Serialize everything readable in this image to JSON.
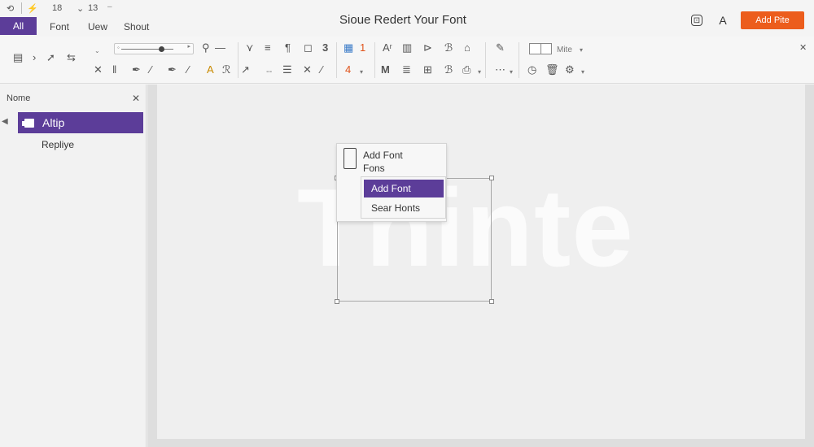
{
  "titlebar": {
    "quick_access": [
      {
        "icon": "undo-icon",
        "glyph": "⟲"
      },
      {
        "icon": "lightning-icon",
        "glyph": "⚡"
      },
      {
        "label": "18"
      },
      {
        "icon": "chevron-down-icon",
        "glyph": "⌄"
      },
      {
        "label": "13"
      }
    ],
    "tabs": [
      {
        "label": "All",
        "active": true
      },
      {
        "label": "Font"
      },
      {
        "label": "Uew"
      },
      {
        "label": "Shout"
      }
    ],
    "document_title": "Sioue Redert Your Font",
    "right_icons": [
      {
        "icon": "share-icon",
        "glyph": "⊡"
      },
      {
        "icon": "font-a-icon",
        "glyph": "A"
      }
    ],
    "action_button": "Add Pite"
  },
  "ribbon": {
    "row1": [
      {
        "icon": "folder-icon",
        "glyph": "▤"
      },
      {
        "icon": "chevron-right-icon",
        "glyph": "›"
      },
      {
        "icon": "arrow-icon",
        "glyph": "➚"
      },
      {
        "icon": "link-icon",
        "glyph": "⇆"
      },
      {
        "icon": "collapse-icon",
        "glyph": "⌄"
      },
      {
        "icon": "zoom-slider-icon",
        "glyph": ""
      },
      {
        "icon": "search-icon",
        "glyph": "⚲"
      },
      {
        "icon": "line-style-icon",
        "glyph": "—"
      },
      {
        "icon": "filter-icon",
        "glyph": "⋎"
      },
      {
        "icon": "align-icon",
        "glyph": "≡"
      },
      {
        "icon": "paragraph-icon",
        "glyph": "¶"
      },
      {
        "icon": "comment-icon",
        "glyph": "◻"
      },
      {
        "label": "3"
      },
      {
        "icon": "document-icon",
        "glyph": "▦"
      },
      {
        "label": "1"
      },
      {
        "icon": "font-size-icon",
        "glyph": "Aʳ"
      },
      {
        "icon": "table-icon",
        "glyph": "▥"
      },
      {
        "icon": "tag-icon",
        "glyph": "⊳"
      },
      {
        "icon": "brush-icon",
        "glyph": "ℬ"
      },
      {
        "icon": "bag-icon",
        "glyph": "⌂"
      },
      {
        "icon": "pencil-icon",
        "glyph": "✎"
      }
    ],
    "row2": [
      {
        "icon": "close-icon",
        "glyph": "✕"
      },
      {
        "icon": "column-icon",
        "glyph": "‖"
      },
      {
        "icon": "pen-icon",
        "glyph": "✒"
      },
      {
        "icon": "eyedropper-icon",
        "glyph": "⁄"
      },
      {
        "icon": "highlight-icon",
        "glyph": "A"
      },
      {
        "icon": "format-icon",
        "glyph": "ℛ"
      },
      {
        "icon": "draw-icon",
        "glyph": "↗"
      },
      {
        "icon": "dash-icon",
        "glyph": "--"
      },
      {
        "icon": "list-icon",
        "glyph": "☰"
      },
      {
        "icon": "cut-icon",
        "glyph": "✕"
      },
      {
        "icon": "slash-icon",
        "glyph": "⁄"
      },
      {
        "label": "4"
      },
      {
        "icon": "macro-icon",
        "glyph": "M"
      },
      {
        "icon": "lines-icon",
        "glyph": "≣"
      },
      {
        "icon": "grid-icon",
        "glyph": "⊞"
      },
      {
        "icon": "printer-icon",
        "glyph": "⎙"
      },
      {
        "icon": "dots-icon",
        "glyph": "⋯"
      },
      {
        "icon": "clock-icon",
        "glyph": "◷"
      },
      {
        "icon": "trash-icon",
        "glyph": "🗑"
      },
      {
        "icon": "settings-icon",
        "glyph": "⚙"
      }
    ],
    "style_label": "Mite"
  },
  "left_pane": {
    "header": "Nome",
    "items": [
      {
        "label": "Altip",
        "active": true
      },
      {
        "label": "Repliye"
      }
    ]
  },
  "canvas": {
    "watermark": "Thinte",
    "popup": {
      "title_line1": "Add Font",
      "title_line2": "Fons"
    },
    "submenu": [
      {
        "label": "Add Font",
        "active": true
      },
      {
        "label": "Sear Honts"
      }
    ]
  },
  "colors": {
    "accent": "#5c3d99",
    "action": "#ec5d1c",
    "canvas_bg": "#efefef"
  }
}
